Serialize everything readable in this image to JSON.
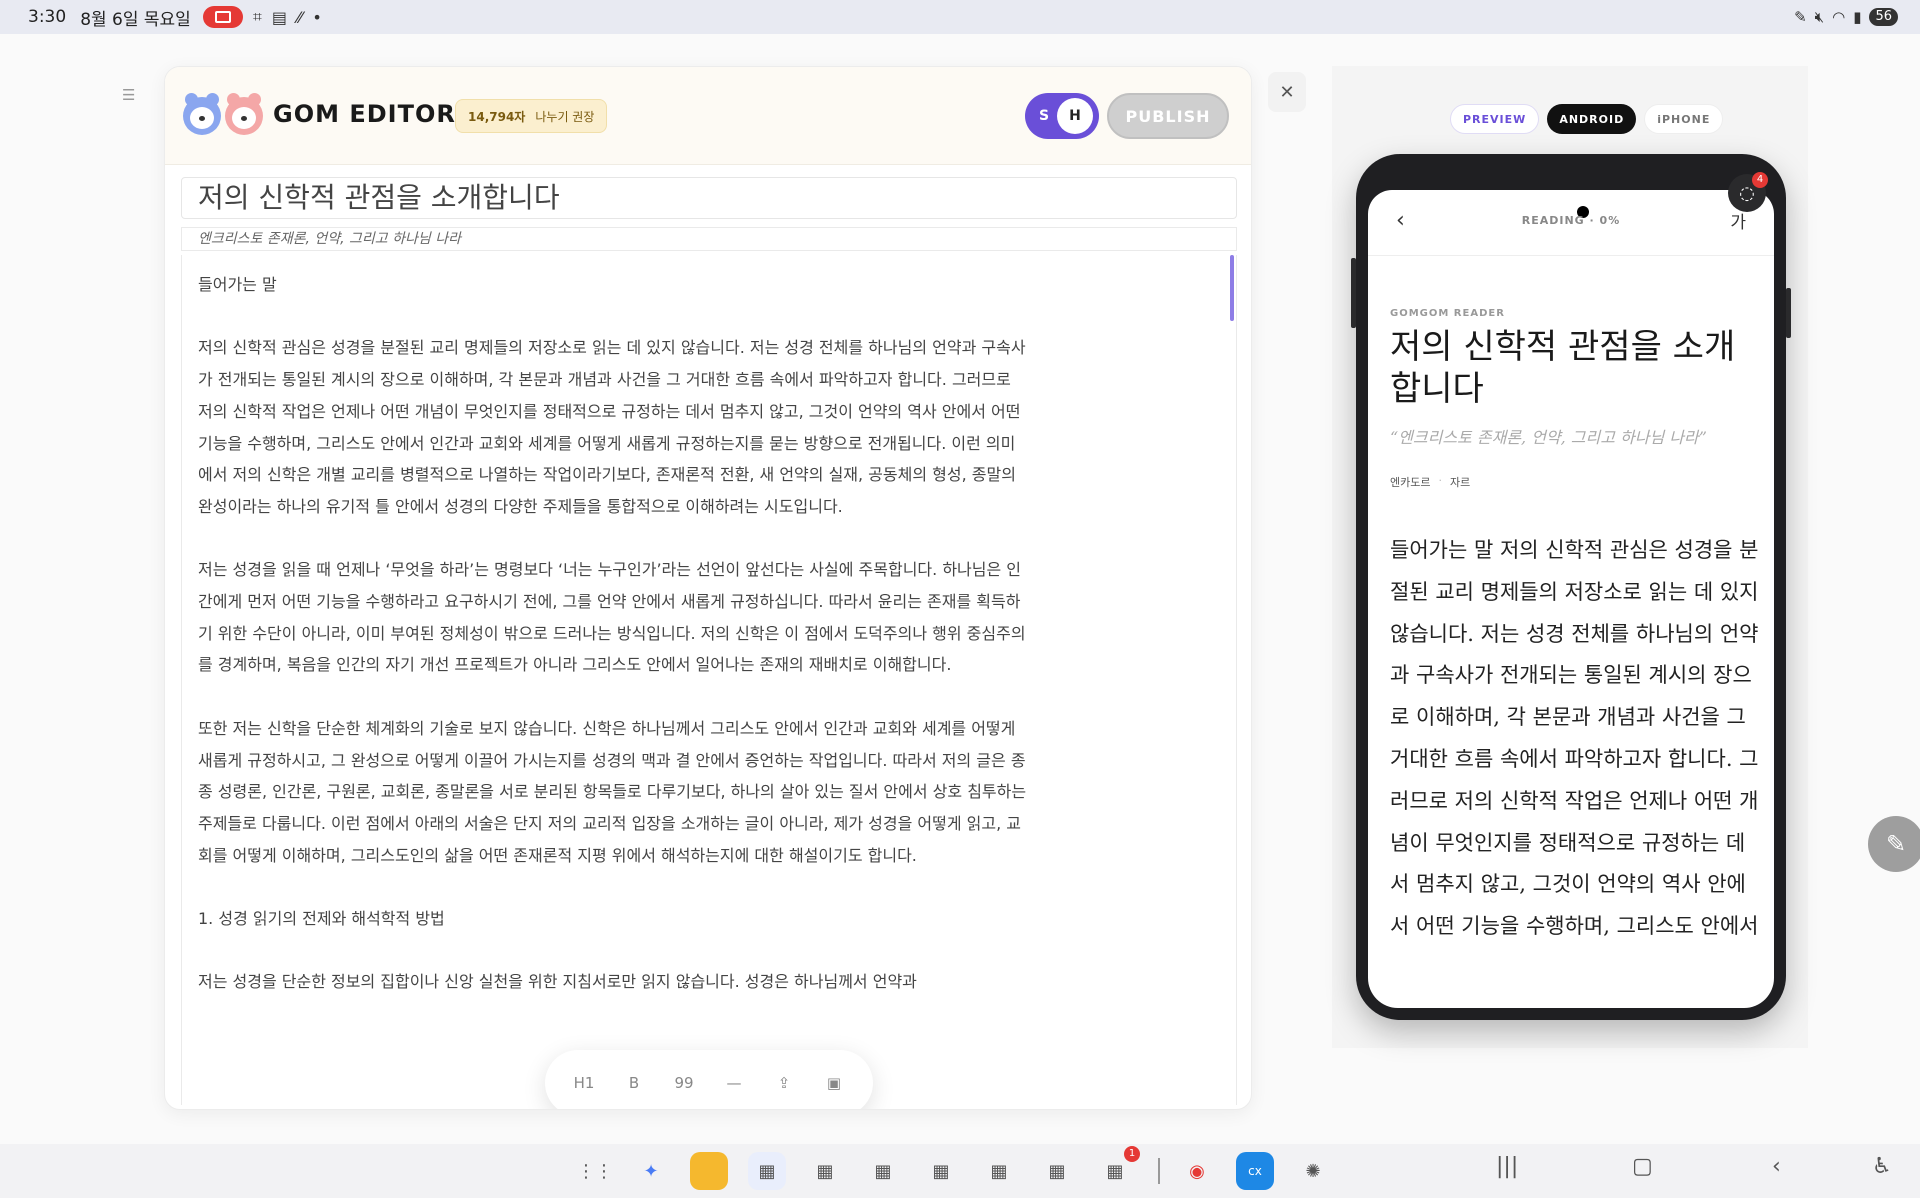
{
  "statusbar": {
    "time": "3:30",
    "date": "8월 6일 목요일",
    "battery": "56"
  },
  "editor": {
    "brand": "GOM EDITOR",
    "char_count": "14,794자",
    "split_hint": "나누기 권장",
    "toggle_s": "S",
    "toggle_h": "H",
    "publish_label": "PUBLISH",
    "title": "저의 신학적 관점을 소개합니다",
    "subtitle": "엔크리스토 존재론, 언약, 그리고 하나님 나라",
    "paragraphs": [
      "들어가는 말",
      "저의 신학적 관심은 성경을 분절된 교리 명제들의 저장소로 읽는 데 있지 않습니다. 저는 성경 전체를 하나님의 언약과 구속사가 전개되는 통일된 계시의 장으로 이해하며, 각 본문과 개념과 사건을 그 거대한 흐름 속에서 파악하고자 합니다. 그러므로 저의 신학적 작업은 언제나 어떤 개념이 무엇인지를 정태적으로 규정하는 데서 멈추지 않고, 그것이 언약의 역사 안에서 어떤 기능을 수행하며, 그리스도 안에서 인간과 교회와 세계를 어떻게 새롭게 규정하는지를 묻는 방향으로 전개됩니다. 이런 의미에서 저의 신학은 개별 교리를 병렬적으로 나열하는 작업이라기보다, 존재론적 전환, 새 언약의 실재, 공동체의 형성, 종말의 완성이라는 하나의 유기적 틀 안에서 성경의 다양한 주제들을 통합적으로 이해하려는 시도입니다.",
      "저는 성경을 읽을 때 언제나 ‘무엇을 하라’는 명령보다 ‘너는 누구인가’라는 선언이 앞선다는 사실에 주목합니다. 하나님은 인간에게 먼저 어떤 기능을 수행하라고 요구하시기 전에, 그를 언약 안에서 새롭게 규정하십니다. 따라서 윤리는 존재를 획득하기 위한 수단이 아니라, 이미 부여된 정체성이 밖으로 드러나는 방식입니다. 저의 신학은 이 점에서 도덕주의나 행위 중심주의를 경계하며, 복음을 인간의 자기 개선 프로젝트가 아니라 그리스도 안에서 일어나는 존재의 재배치로 이해합니다.",
      "또한 저는 신학을 단순한 체계화의 기술로 보지 않습니다. 신학은 하나님께서 그리스도 안에서 인간과 교회와 세계를 어떻게 새롭게 규정하시고, 그 완성으로 어떻게 이끌어 가시는지를 성경의 맥과 결 안에서 증언하는 작업입니다. 따라서 저의 글은 종종 성령론, 인간론, 구원론, 교회론, 종말론을 서로 분리된 항목들로 다루기보다, 하나의 살아 있는 질서 안에서 상호 침투하는 주제들로 다룹니다. 이런 점에서 아래의 서술은 단지 저의 교리적 입장을 소개하는 글이 아니라, 제가 성경을 어떻게 읽고, 교회를 어떻게 이해하며, 그리스도인의 삶을 어떤 존재론적 지평 위에서 해석하는지에 대한 해설이기도 합니다.",
      "1. 성경 읽기의 전제와 해석학적 방법",
      "저는 성경을 단순한 정보의 집합이나 신앙 실천을 위한 지침서로만 읽지 않습니다. 성경은 하나님께서 언약과"
    ],
    "toolbar": [
      "H1",
      "B",
      "99",
      "—",
      "⇪",
      "▣"
    ]
  },
  "preview": {
    "tabs": [
      "PREVIEW",
      "ANDROID",
      "iPHONE"
    ],
    "notif_count": "4",
    "reading": "READING · 0%",
    "font_btn": "가",
    "kicker": "GOMGOM READER",
    "title": "저의 신학적 관점을 소개합니다",
    "subtitle": "“엔크리스토 존재론, 언약, 그리고 하나님 나라”",
    "meta_a": "엔카도르",
    "meta_b": "자르",
    "body": "들어가는 말 저의 신학적 관심은 성경을 분절된 교리 명제들의 저장소로 읽는 데 있지 않습니다. 저는 성경 전체를 하나님의 언약과 구속사가 전개되는 통일된 계시의 장으로 이해하며, 각 본문과 개념과 사건을 그 거대한 흐름 속에서 파악하고자 합니다. 그러므로 저의 신학적 작업은 언제나 어떤 개념이 무엇인지를 정태적으로 규정하는 데서 멈추지 않고, 그것이 언약의 역사 안에서 어떤 기능을 수행하며, 그리스도 안에서"
  },
  "taskbar": {
    "notif_badge": "1"
  }
}
